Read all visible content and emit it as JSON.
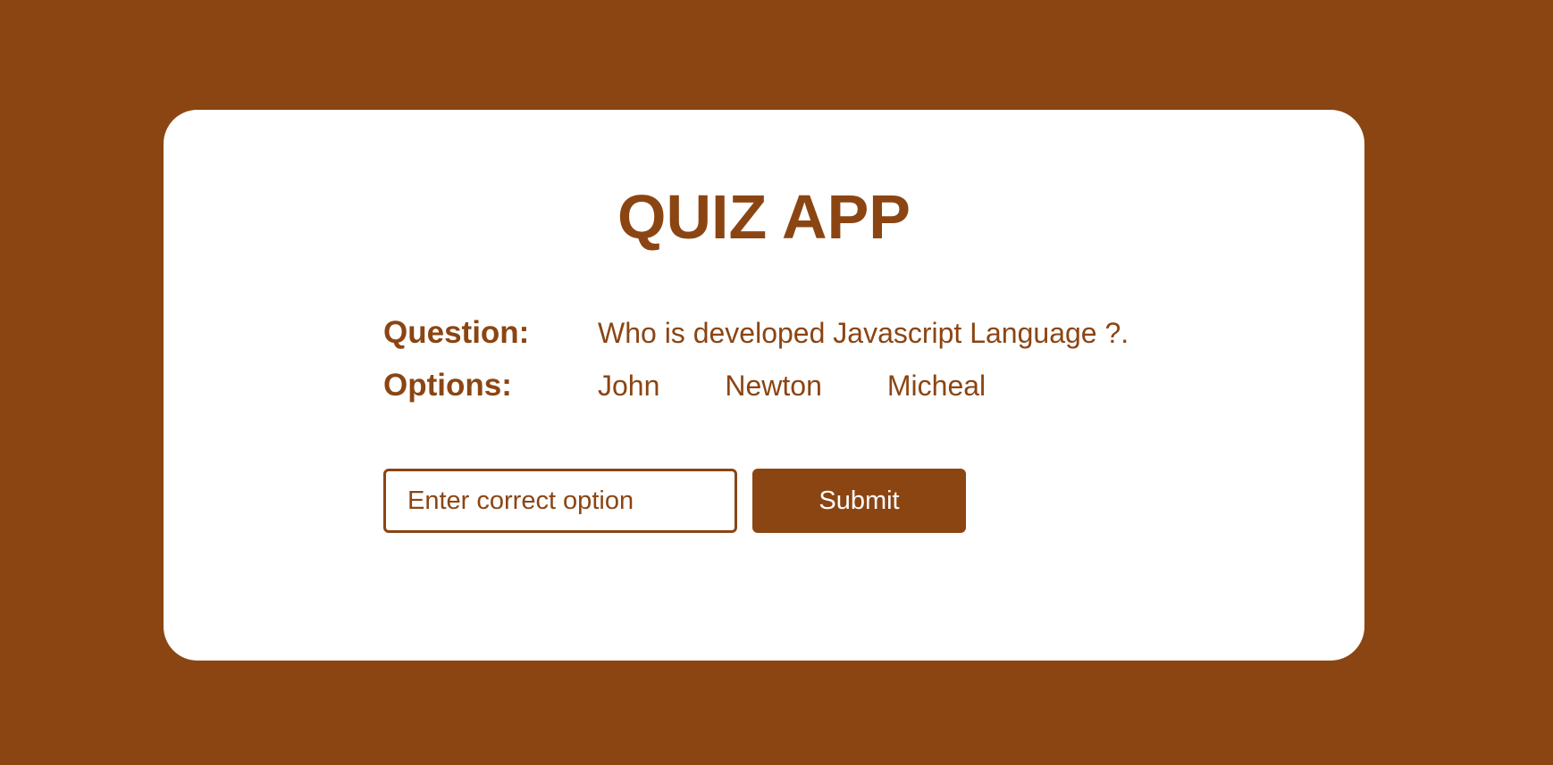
{
  "app": {
    "title": "QUIZ APP"
  },
  "quiz": {
    "question_label": "Question:",
    "question_text": "Who is developed Javascript Language ?.",
    "options_label": "Options:",
    "options": [
      "John",
      "Newton",
      "Micheal"
    ]
  },
  "answer_input": {
    "placeholder": "Enter correct option",
    "value": ""
  },
  "submit": {
    "label": "Submit"
  },
  "colors": {
    "brand": "#8B4513",
    "card": "#FFFFFF",
    "button_text": "#FFFFFF"
  }
}
